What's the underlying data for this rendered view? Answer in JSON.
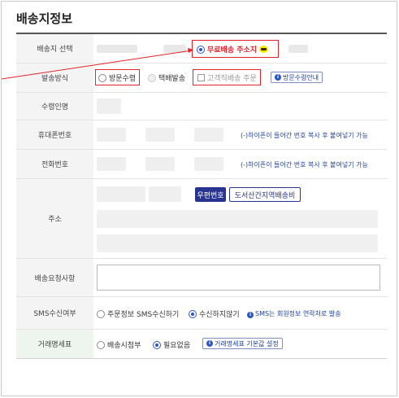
{
  "page": {
    "title": "배송지정보"
  },
  "rows": {
    "address_select": {
      "label": "배송지 선택",
      "option": "무료배송 주소지"
    },
    "delivery_method": {
      "label": "발송방식",
      "visit_pickup": "방문수령",
      "courier": "택배발송",
      "direct_order": "고객직배송 주문",
      "visit_guide": "방문수령안내"
    },
    "recipient": {
      "label": "수령인명"
    },
    "mobile": {
      "label": "휴대폰번호",
      "note": "(-)하이픈이 들어간 번호 복사 후 붙여넣기 가능"
    },
    "phone": {
      "label": "전화번호",
      "note": "(-)하이픈이 들어간 번호 복사 후 붙여넣기 가능"
    },
    "address": {
      "label": "주소",
      "postcode_button": "우편번호",
      "island_button": "도서산간지역배송비"
    },
    "request": {
      "label": "배송요청사항"
    },
    "sms": {
      "label": "SMS수신여부",
      "opt_in": "주문정보 SMS수신하기",
      "opt_out": "수신하지않기",
      "note": "SMS는 회원정보 연락처로 발송"
    },
    "statement": {
      "label": "거래명세표",
      "attach": "배송시첨부",
      "none": "필요없음",
      "settings": "거래명세표 기본값 설정"
    }
  },
  "colors": {
    "accent": "#28348f",
    "highlight": "#e0242a",
    "radio_selected": "#2a56c6"
  },
  "icons": {
    "info": "info-icon",
    "kakao": "kakao-talk-icon"
  }
}
